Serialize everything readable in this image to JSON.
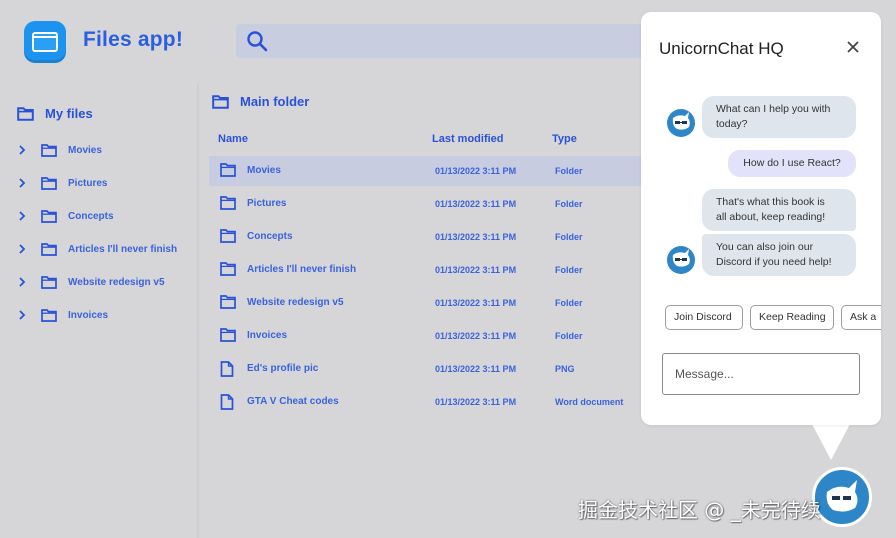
{
  "header": {
    "app_title": "Files app!",
    "search_placeholder": ""
  },
  "sidebar": {
    "root_label": "My files",
    "items": [
      {
        "label": "Movies"
      },
      {
        "label": "Pictures"
      },
      {
        "label": "Concepts"
      },
      {
        "label": "Articles I'll never finish"
      },
      {
        "label": "Website redesign v5"
      },
      {
        "label": "Invoices"
      }
    ]
  },
  "main": {
    "folder_title": "Main folder",
    "columns": {
      "name": "Name",
      "modified": "Last modified",
      "type": "Type"
    },
    "rows": [
      {
        "name": "Movies",
        "modified": "01/13/2022 3:11 PM",
        "type": "Folder",
        "icon": "folder-icon",
        "selected": true
      },
      {
        "name": "Pictures",
        "modified": "01/13/2022 3:11 PM",
        "type": "Folder",
        "icon": "folder-icon"
      },
      {
        "name": "Concepts",
        "modified": "01/13/2022 3:11 PM",
        "type": "Folder",
        "icon": "folder-icon"
      },
      {
        "name": "Articles I'll never finish",
        "modified": "01/13/2022 3:11 PM",
        "type": "Folder",
        "icon": "folder-icon"
      },
      {
        "name": "Website redesign v5",
        "modified": "01/13/2022 3:11 PM",
        "type": "Folder",
        "icon": "folder-icon"
      },
      {
        "name": "Invoices",
        "modified": "01/13/2022 3:11 PM",
        "type": "Folder",
        "icon": "folder-icon"
      },
      {
        "name": "Ed's profile pic",
        "modified": "01/13/2022 3:11 PM",
        "type": "PNG",
        "icon": "file-icon"
      },
      {
        "name": "GTA V Cheat codes",
        "modified": "01/13/2022 3:11 PM",
        "type": "Word document",
        "icon": "file-icon"
      }
    ]
  },
  "chat": {
    "title": "UnicornChat HQ",
    "messages": [
      {
        "from": "bot",
        "text_lines": [
          "What can I help you with",
          "today?"
        ]
      },
      {
        "from": "user",
        "text_lines": [
          "How do I use React?"
        ]
      },
      {
        "from": "bot",
        "text_lines": [
          "That's what this book is",
          "all about, keep reading!"
        ]
      },
      {
        "from": "bot",
        "text_lines": [
          "You can also join our",
          "Discord if you need help!"
        ]
      }
    ],
    "quick_replies": [
      "Join Discord",
      "Keep Reading",
      "Ask a"
    ],
    "input_placeholder": "Message..."
  },
  "watermark": "掘金技术社区 @ _未完待续",
  "colors": {
    "accent": "#2a52d8",
    "selected_row": "#c8cce0",
    "page_background": "#d6d6d8",
    "bot_bubble": "#dfe5ec",
    "user_bubble": "#e2e2fb",
    "launcher": "#2d86c7"
  }
}
